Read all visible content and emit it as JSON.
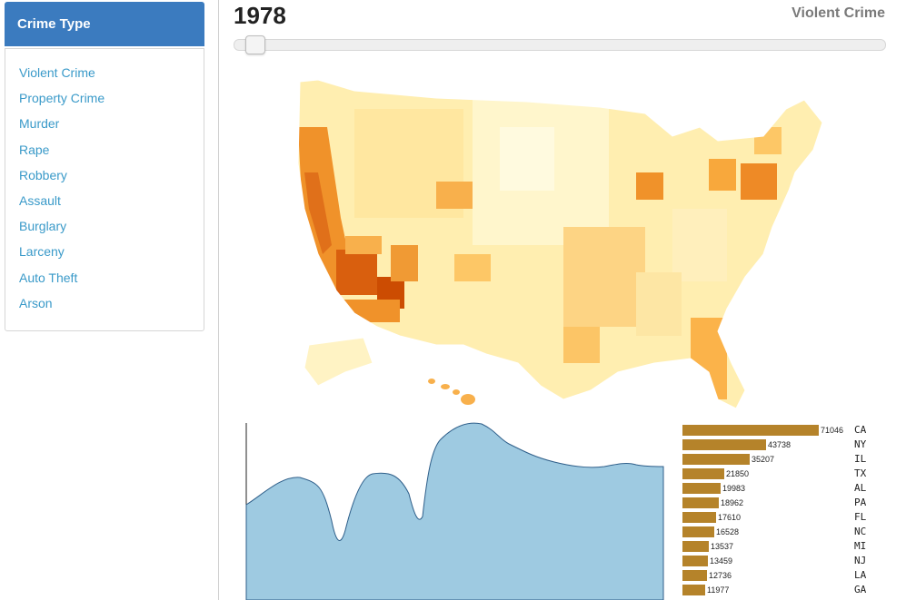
{
  "sidebar": {
    "header": "Crime Type",
    "items": [
      {
        "label": "Violent Crime"
      },
      {
        "label": "Property Crime"
      },
      {
        "label": "Murder"
      },
      {
        "label": "Rape"
      },
      {
        "label": "Robbery"
      },
      {
        "label": "Assault"
      },
      {
        "label": "Burglary"
      },
      {
        "label": "Larceny"
      },
      {
        "label": "Auto Theft"
      },
      {
        "label": "Arson"
      }
    ]
  },
  "main": {
    "year": "1978",
    "crime_title": "Violent Crime",
    "slider_position": 0.03
  },
  "colors": {
    "accent": "#3b7bbf",
    "link": "#3a9ac9",
    "bar": "#b5832a",
    "area_fill": "#9ecae1",
    "area_stroke": "#2f5f8a"
  },
  "map": {
    "icon": "us-county-choropleth-map"
  },
  "ranking": [
    {
      "state": "CA",
      "value": 71046
    },
    {
      "state": "NY",
      "value": 43738
    },
    {
      "state": "IL",
      "value": 35207
    },
    {
      "state": "TX",
      "value": 21850
    },
    {
      "state": "AL",
      "value": 19983
    },
    {
      "state": "PA",
      "value": 18962
    },
    {
      "state": "FL",
      "value": 17610
    },
    {
      "state": "NC",
      "value": 16528
    },
    {
      "state": "MI",
      "value": 13537
    },
    {
      "state": "NJ",
      "value": 13459
    },
    {
      "state": "LA",
      "value": 12736
    },
    {
      "state": "GA",
      "value": 11977
    }
  ]
}
